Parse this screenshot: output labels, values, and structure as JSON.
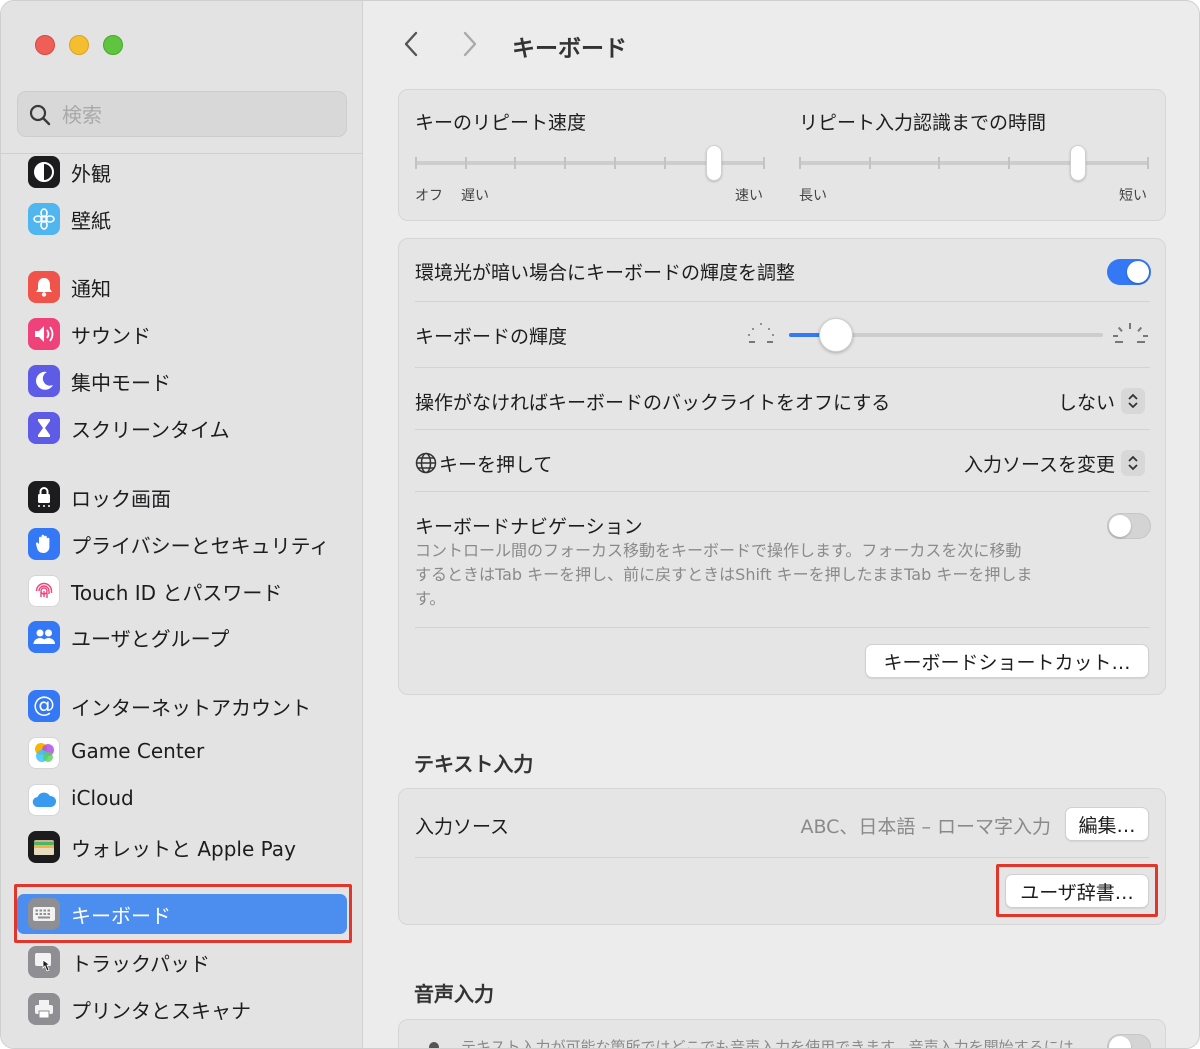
{
  "window": {
    "title": "キーボード"
  },
  "search": {
    "placeholder": "検索",
    "icon": "magnifier"
  },
  "sidebar": {
    "items": [
      {
        "label": "外観",
        "icon": "appearance-icon",
        "color": "#1c1c1e"
      },
      {
        "label": "壁紙",
        "icon": "wallpaper-flower-icon",
        "color": "#4fb6f0"
      },
      {
        "label": "通知",
        "icon": "bell-icon",
        "color": "#f0534a"
      },
      {
        "label": "サウンド",
        "icon": "speaker-icon",
        "color": "#f0427a"
      },
      {
        "label": "集中モード",
        "icon": "moon-icon",
        "color": "#5e5ce6"
      },
      {
        "label": "スクリーンタイム",
        "icon": "hourglass-icon",
        "color": "#5e5ce6"
      },
      {
        "label": "ロック画面",
        "icon": "lock-icon",
        "color": "#1c1c1e"
      },
      {
        "label": "プライバシーとセキュリティ",
        "icon": "hand-icon",
        "color": "#3478f6"
      },
      {
        "label": "Touch ID とパスワード",
        "icon": "fingerprint-icon",
        "color": "#ffffff"
      },
      {
        "label": "ユーザとグループ",
        "icon": "users-icon",
        "color": "#3478f6"
      },
      {
        "label": "インターネットアカウント",
        "icon": "at-icon",
        "color": "#3478f6"
      },
      {
        "label": "Game Center",
        "icon": "game-center-icon",
        "color": "#ffffff"
      },
      {
        "label": "iCloud",
        "icon": "cloud-icon",
        "color": "#ffffff"
      },
      {
        "label": "ウォレットと Apple Pay",
        "icon": "wallet-icon",
        "color": "#1c1c1e"
      },
      {
        "label": "キーボード",
        "icon": "keyboard-icon",
        "color": "#8e8e93",
        "selected": true
      },
      {
        "label": "トラックパッド",
        "icon": "trackpad-icon",
        "color": "#8e8e93"
      },
      {
        "label": "プリンタとスキャナ",
        "icon": "printer-icon",
        "color": "#8e8e93"
      }
    ]
  },
  "repeat": {
    "rate_title": "キーのリピート速度",
    "rate_left_off": "オフ",
    "rate_left_slow": "遅い",
    "rate_right": "速い",
    "rate_value": 6,
    "rate_steps": 8,
    "delay_title": "リピート入力認識までの時間",
    "delay_left": "長い",
    "delay_right": "短い",
    "delay_value": 4,
    "delay_steps": 6
  },
  "backlight": {
    "auto_label": "環境光が暗い場合にキーボードの輝度を調整",
    "auto_on": true,
    "brightness_label": "キーボードの輝度",
    "brightness_value": 0.08,
    "off_label": "操作がなければキーボードのバックライトをオフにする",
    "off_value": "しない"
  },
  "globe": {
    "label": "キーを押して",
    "value": "入力ソースを変更"
  },
  "navigation": {
    "label": "キーボードナビゲーション",
    "enabled": false,
    "description": "コントロール間のフォーカス移動をキーボードで操作します。フォーカスを次に移動するときはTab キーを押し、前に戻すときはShift キーを押したままTab キーを押します。"
  },
  "shortcuts_button": "キーボードショートカット…",
  "text_input": {
    "section_title": "テキスト入力",
    "sources_label": "入力ソース",
    "sources_value": "ABC、日本語 – ローマ字入力",
    "edit_button": "編集…",
    "dictionary_button": "ユーザ辞書…"
  },
  "dictation": {
    "section_title": "音声入力",
    "description": "テキスト入力が可能な箇所ではどこでも音声入力を使用できます。音声入力を開始するには"
  },
  "colors": {
    "accent": "#3478f6",
    "selection": "#4c8ef0",
    "highlight": "#e0362c"
  }
}
